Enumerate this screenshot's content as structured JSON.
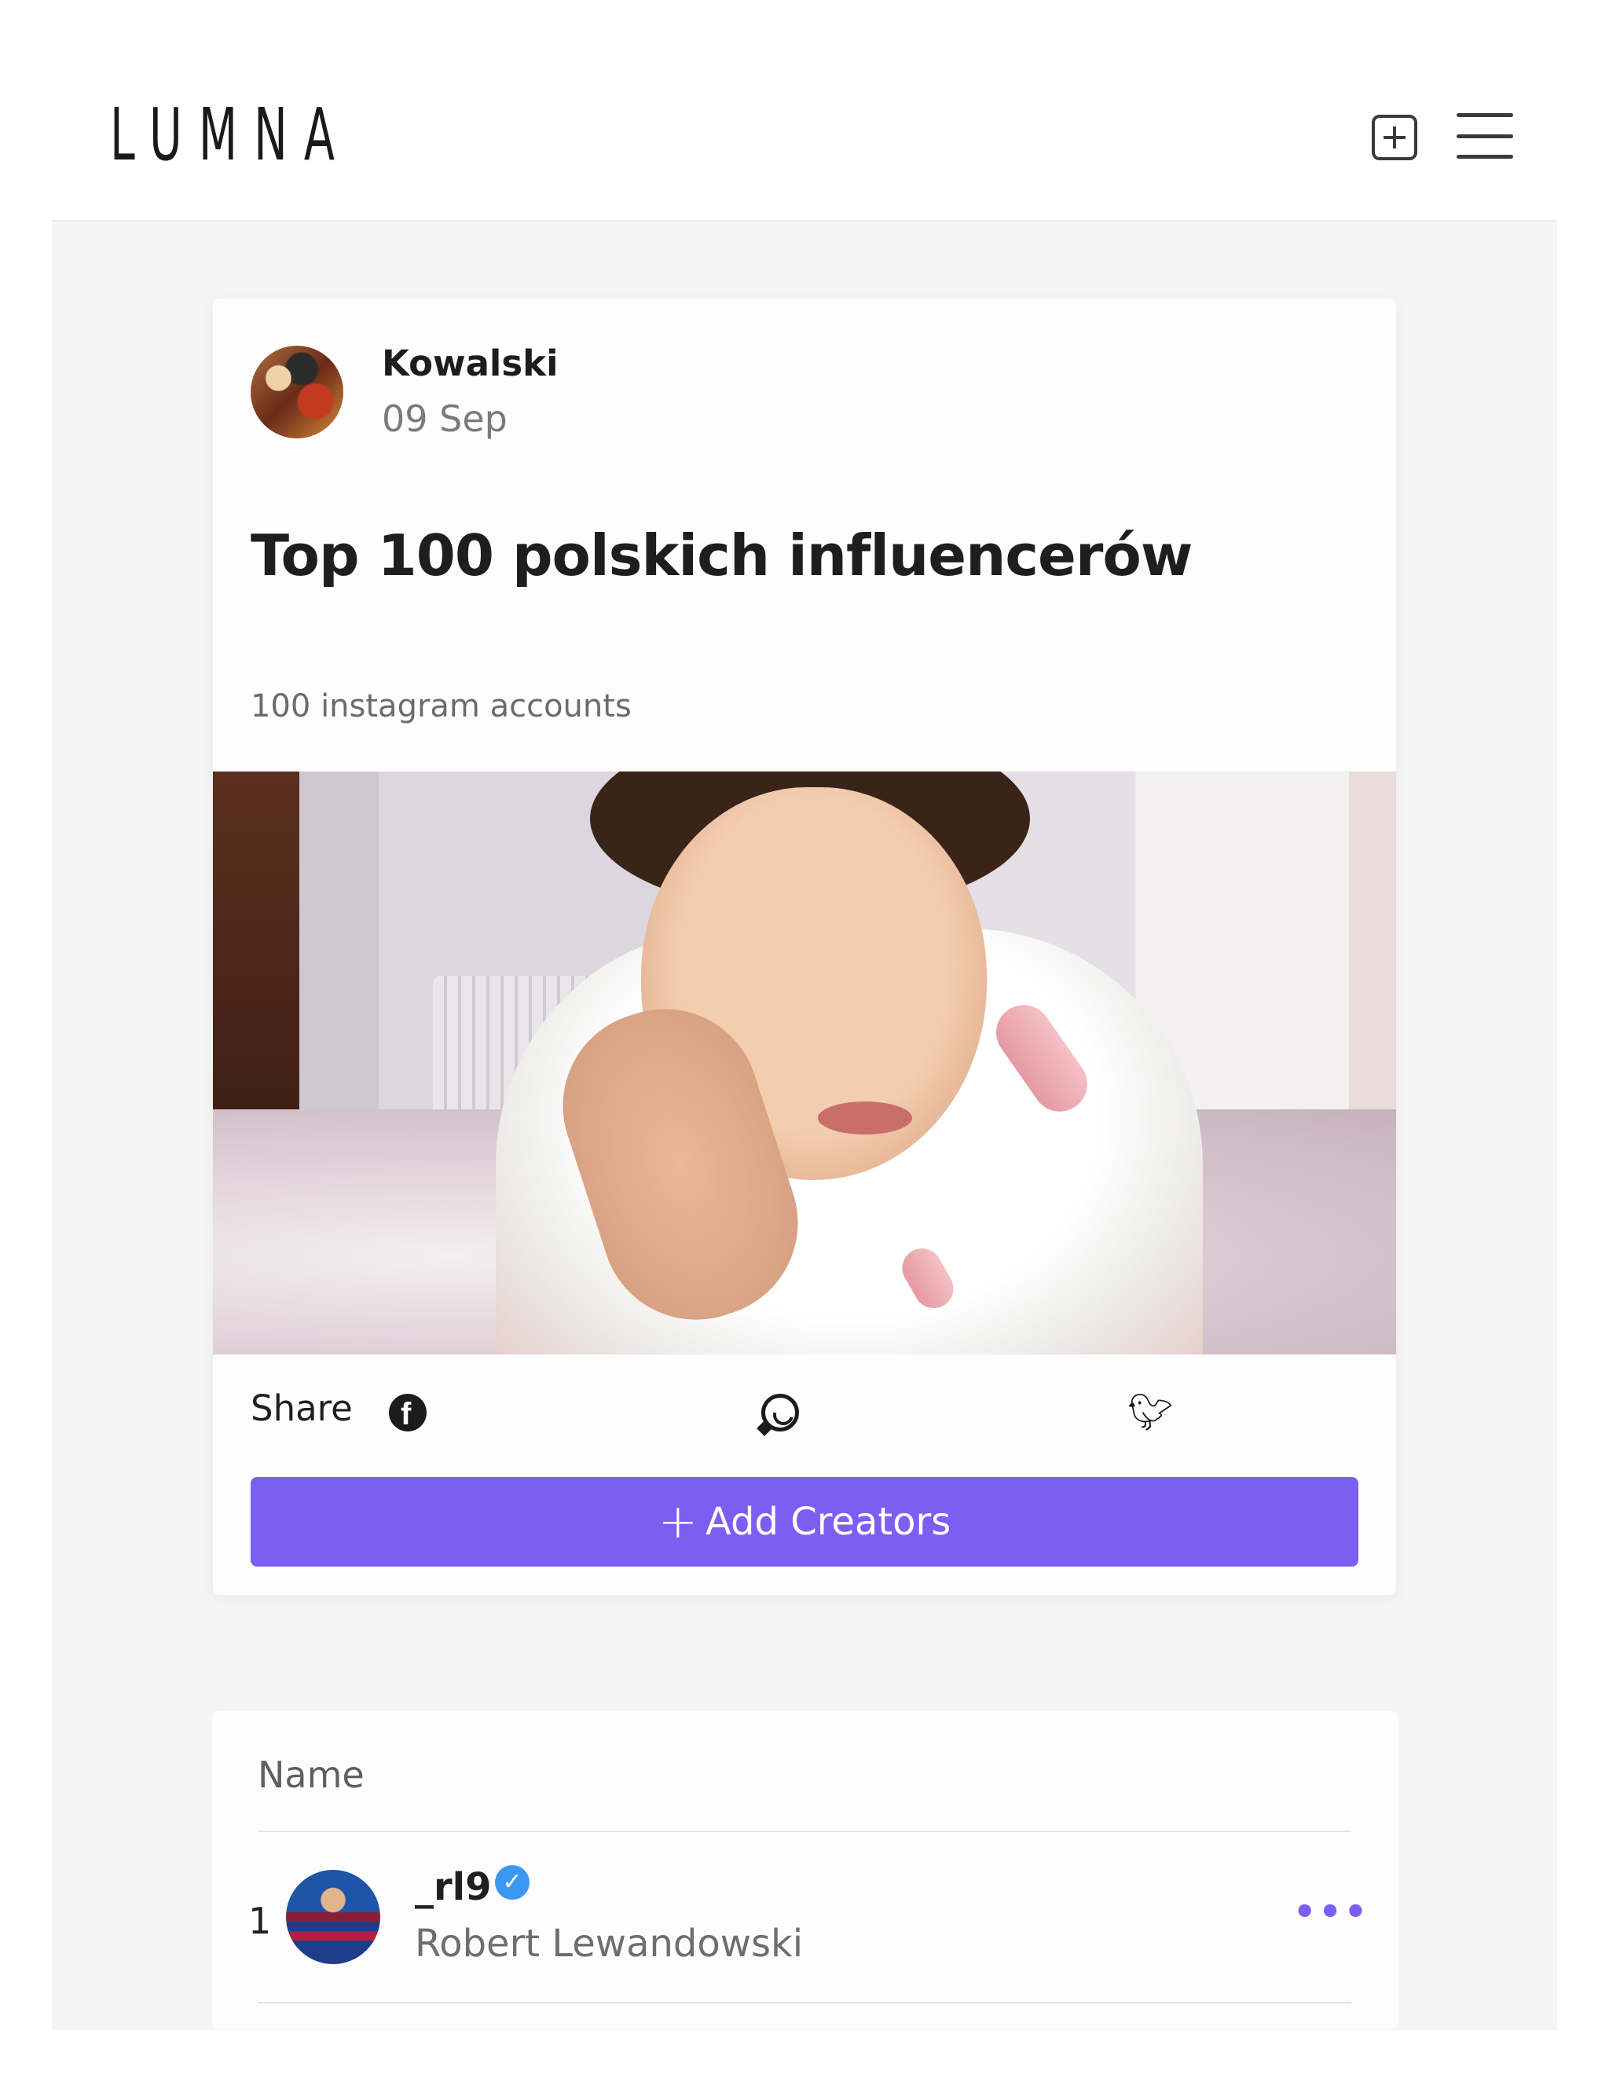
{
  "header": {
    "logo": "LUMNA",
    "add_icon": "plus-square-icon",
    "menu_icon": "hamburger-menu-icon"
  },
  "post": {
    "author": "Kowalski",
    "date": "09 Sep",
    "title": "Top 100 polskich influencerów",
    "subtitle": "100 instagram accounts",
    "share_label": "Share",
    "share_icons": [
      "facebook-icon",
      "whatsapp-icon",
      "twitter-icon"
    ],
    "add_button_label": "Add Creators",
    "accent_color": "#7b5ff3"
  },
  "list": {
    "column_header": "Name",
    "rows": [
      {
        "rank": "1",
        "handle": "_rl9",
        "verified": true,
        "full_name": "Robert Lewandowski"
      }
    ],
    "more_label": "•••"
  }
}
